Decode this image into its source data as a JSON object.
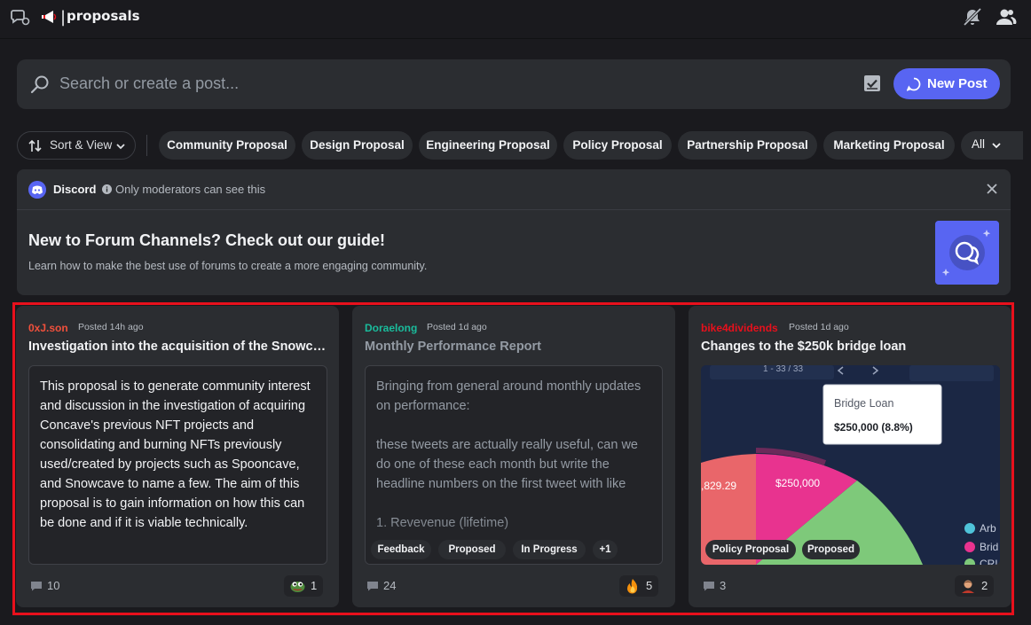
{
  "header": {
    "separator": "|",
    "channel_name": "proposals"
  },
  "search": {
    "placeholder": "Search or create a post...",
    "new_post_label": "New Post"
  },
  "filters": {
    "sort_label": "Sort & View",
    "tags": [
      "Community Proposal",
      "Design Proposal",
      "Engineering Proposal",
      "Policy Proposal",
      "Partnership Proposal",
      "Marketing Proposal"
    ],
    "all_label": "All"
  },
  "notice": {
    "source": "Discord",
    "visibility": "Only moderators can see this",
    "title": "New to Forum Channels? Check out our guide!",
    "subtitle": "Learn how to make the best use of forums to create a more engaging community."
  },
  "posts": [
    {
      "author": "0xJ.son",
      "author_color": "#f0503c",
      "posted": "Posted 14h ago",
      "title": "Investigation into the acquisition of the Snowcave",
      "body": "This proposal is to generate community interest and discussion in the investigation of acquiring Concave's previous NFT projects and consolidating and burning NFTs previously used/created by projects such as Spooncave, and Snowcave to name a few. The aim of this proposal is to gain information on how this can be done and if it is viable technically.",
      "comments": "10",
      "reaction_icon": "pepe-emoji-icon",
      "reaction_count": "1"
    },
    {
      "author": "Doraelong",
      "author_color": "#1abc9c",
      "posted": "Posted 1d ago",
      "title": "Monthly Performance Report",
      "body": "Bringing from general around monthly updates on performance:\n\nthese tweets are actually really useful, can we do one of these each month but write the headline numbers on the first tweet with like\n\n1. Revevenue (lifetime)",
      "tags": [
        "Feedback",
        "Proposed",
        "In Progress",
        "+1"
      ],
      "comments": "24",
      "reaction_icon": "fire-emoji-icon",
      "reaction_count": "5"
    },
    {
      "author": "bike4dividends",
      "author_color": "#e8101c",
      "posted": "Posted 1d ago",
      "title": "Changes to the $250k bridge loan",
      "image": {
        "tooltip_label": "Bridge Loan",
        "tooltip_value": "$250,000 (8.8%)",
        "slice_label_left": ",829.29",
        "slice_label_mid": "$250,000",
        "pager": "1 - 33 / 33",
        "legend": [
          "Arb",
          "Brid",
          "CRL"
        ]
      },
      "tags": [
        "Policy Proposal",
        "Proposed"
      ],
      "comments": "3",
      "reaction_icon": "person-emoji-icon",
      "reaction_count": "2"
    }
  ]
}
